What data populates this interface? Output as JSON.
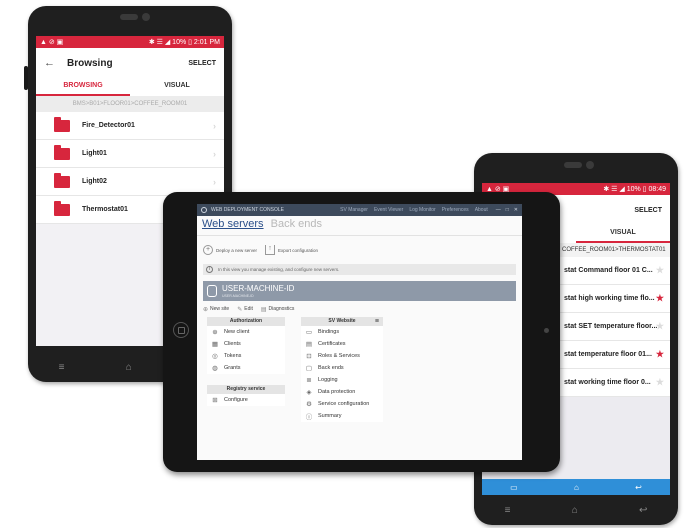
{
  "phone_left": {
    "status": {
      "left": "▲ ⊘ ▣",
      "right": "✱ ☰ ◢ 10% ▯ 2:01 PM"
    },
    "appbar": {
      "back": "←",
      "title": "Browsing",
      "select": "SELECT"
    },
    "tabs": [
      "BROWSING",
      "VISUAL"
    ],
    "path": "BMS>B01>FLOOR01>COFFEE_ROOM01",
    "items": [
      {
        "label": "Fire_Detector01"
      },
      {
        "label": "Light01"
      },
      {
        "label": "Light02"
      },
      {
        "label": "Thermostat01"
      }
    ],
    "chevron": "›",
    "nav": {
      "menu": "≡",
      "home": "⌂",
      "back": "↩"
    }
  },
  "phone_right": {
    "status": {
      "left": "▲ ⊘ ▣",
      "right": "✱ ☰ ◢ 10% ▯ 08:49"
    },
    "appbar": {
      "select": "SELECT"
    },
    "tabs": [
      "",
      "VISUAL"
    ],
    "path": "COFFEE_ROOM01>THERMOSTAT01",
    "items": [
      {
        "label": "stat Command floor 01 C...",
        "starred": false
      },
      {
        "label": "stat high working time flo...",
        "starred": true
      },
      {
        "label": "stat SET temperature floor...",
        "starred": false
      },
      {
        "label": "stat temperature floor 01...",
        "starred": true
      },
      {
        "label": "stat working time floor 0...",
        "starred": false
      }
    ],
    "star": "★",
    "bottom_bar": {
      "left": "▭",
      "home": "⌂",
      "back": "↩"
    },
    "nav": {
      "menu": "≡",
      "home": "⌂",
      "back": "↩"
    }
  },
  "tablet": {
    "window": {
      "title": "WEB DEPLOYMENT CONSOLE",
      "menu": [
        "SV Manager",
        "Event Viewer",
        "Log Monitor",
        "Preferences",
        "About"
      ],
      "controls": {
        "minimize": "—",
        "maximize": "□",
        "close": "✕"
      }
    },
    "heading": {
      "active": "Web servers",
      "inactive": "Back ends"
    },
    "actions": {
      "deploy": "Deploy a new server",
      "export": "Export configuration"
    },
    "info": "In this view you manage existing, and configure new servers.",
    "machine": {
      "name": "USER-MACHINE-ID",
      "sub": "USER-MACHINE-ID"
    },
    "subactions": {
      "new_site": "New site",
      "edit": "Edit",
      "diagnostics": "Diagnostics"
    },
    "authorization": {
      "title": "Authorization",
      "items": [
        {
          "icon": "⊕",
          "label": "New client"
        },
        {
          "icon": "▦",
          "label": "Clients"
        },
        {
          "icon": "◎",
          "label": "Tokens"
        },
        {
          "icon": "◍",
          "label": "Grants"
        }
      ]
    },
    "registry": {
      "title": "Registry service",
      "items": [
        {
          "icon": "⊞",
          "label": "Configure"
        }
      ]
    },
    "sv_website": {
      "title": "SV Website",
      "items": [
        {
          "icon": "▭",
          "label": "Bindings"
        },
        {
          "icon": "▤",
          "label": "Certificates"
        },
        {
          "icon": "⊡",
          "label": "Roles & Services"
        },
        {
          "icon": "▢",
          "label": "Back ends"
        },
        {
          "icon": "≣",
          "label": "Logging"
        },
        {
          "icon": "◈",
          "label": "Data protection"
        },
        {
          "icon": "⚙",
          "label": "Service configuration"
        },
        {
          "icon": "ⓘ",
          "label": "Summary"
        }
      ]
    }
  }
}
